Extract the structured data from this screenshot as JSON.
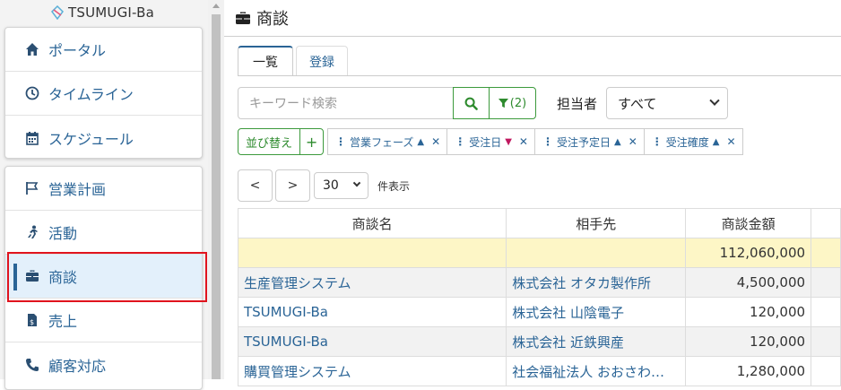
{
  "app": {
    "logo": "TSUMUGI-Ba"
  },
  "sidebar": {
    "group1": [
      {
        "label": "ポータル",
        "icon": "home-icon"
      },
      {
        "label": "タイムライン",
        "icon": "clock-icon"
      },
      {
        "label": "スケジュール",
        "icon": "calendar-icon"
      }
    ],
    "group2": [
      {
        "label": "営業計画",
        "icon": "flag-icon"
      },
      {
        "label": "活動",
        "icon": "running-icon"
      },
      {
        "label": "商談",
        "icon": "briefcase-icon",
        "active": true
      },
      {
        "label": "売上",
        "icon": "invoice-icon"
      },
      {
        "label": "顧客対応",
        "icon": "phone-icon"
      }
    ]
  },
  "header": {
    "title": "商談"
  },
  "tabs": [
    {
      "label": "一覧",
      "active": true
    },
    {
      "label": "登録"
    }
  ],
  "search": {
    "placeholder": "キーワード検索",
    "filter_count": "(2)"
  },
  "owner": {
    "label": "担当者",
    "value": "すべて"
  },
  "sort": {
    "label": "並び替え",
    "add": "+",
    "chips": [
      {
        "label": "営業フェーズ",
        "dir": "asc"
      },
      {
        "label": "受注日",
        "dir": "desc"
      },
      {
        "label": "受注予定日",
        "dir": "asc"
      },
      {
        "label": "受注確度",
        "dir": "asc"
      }
    ]
  },
  "pager": {
    "prev": "<",
    "next": ">",
    "per_page": "30",
    "per_page_label": "件表示"
  },
  "table": {
    "headers": [
      "商談名",
      "相手先",
      "商談金額"
    ],
    "total": "112,060,000",
    "rows": [
      {
        "name": "生産管理システム",
        "client": "株式会社 オタカ製作所",
        "amount": "4,500,000"
      },
      {
        "name": "TSUMUGI-Ba",
        "client": "株式会社 山陰電子",
        "amount": "120,000"
      },
      {
        "name": "TSUMUGI-Ba",
        "client": "株式会社 近鉄興産",
        "amount": "120,000"
      },
      {
        "name": "購買管理システム",
        "client": "社会福祉法人 おおさわ…",
        "amount": "1,280,000"
      }
    ]
  },
  "colors": {
    "link": "#2a6496",
    "green": "#2e8b2e",
    "highlight": "#e0141e",
    "total_row": "#fdf6c6"
  }
}
